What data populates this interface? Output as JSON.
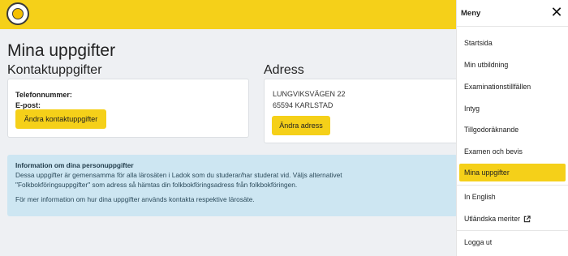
{
  "header": {
    "logo_icon": "ladok-sun-logo-icon",
    "accent": "#f5d019"
  },
  "page": {
    "title": "Mina uppgifter",
    "contact": {
      "heading": "Kontaktuppgifter",
      "phone_label": "Telefonnummer:",
      "email_label": "E-post:",
      "button": "Ändra kontaktuppgifter"
    },
    "address": {
      "heading": "Adress",
      "line1": "LUNGVIKSVÄGEN 22",
      "line2": "65594 KARLSTAD",
      "button": "Ändra adress"
    },
    "info": {
      "title": "Information om dina personuppgifter",
      "line1": "Dessa uppgifter är gemensamma för alla lärosäten i Ladok som du studerar/har studerat vid. Väljs alternativet",
      "line2": "\"Folkbokföringsuppgifter\" som adress så hämtas din folkbokföringsadress från folkbokföringen.",
      "line3": "För mer information om hur dina uppgifter används kontakta respektive lärosäte."
    }
  },
  "menu": {
    "title": "Meny",
    "close_icon": "close-icon",
    "items": [
      {
        "label": "Startsida"
      },
      {
        "label": "Min utbildning"
      },
      {
        "label": "Examinationstillfällen"
      },
      {
        "label": "Intyg"
      },
      {
        "label": "Tillgodoräknande"
      },
      {
        "label": "Examen och bevis"
      },
      {
        "label": "Mina uppgifter",
        "active": true
      },
      {
        "label": "In English"
      },
      {
        "label": "Utländska meriter",
        "icon": "external-link-icon"
      },
      {
        "label": "Logga ut"
      }
    ]
  }
}
